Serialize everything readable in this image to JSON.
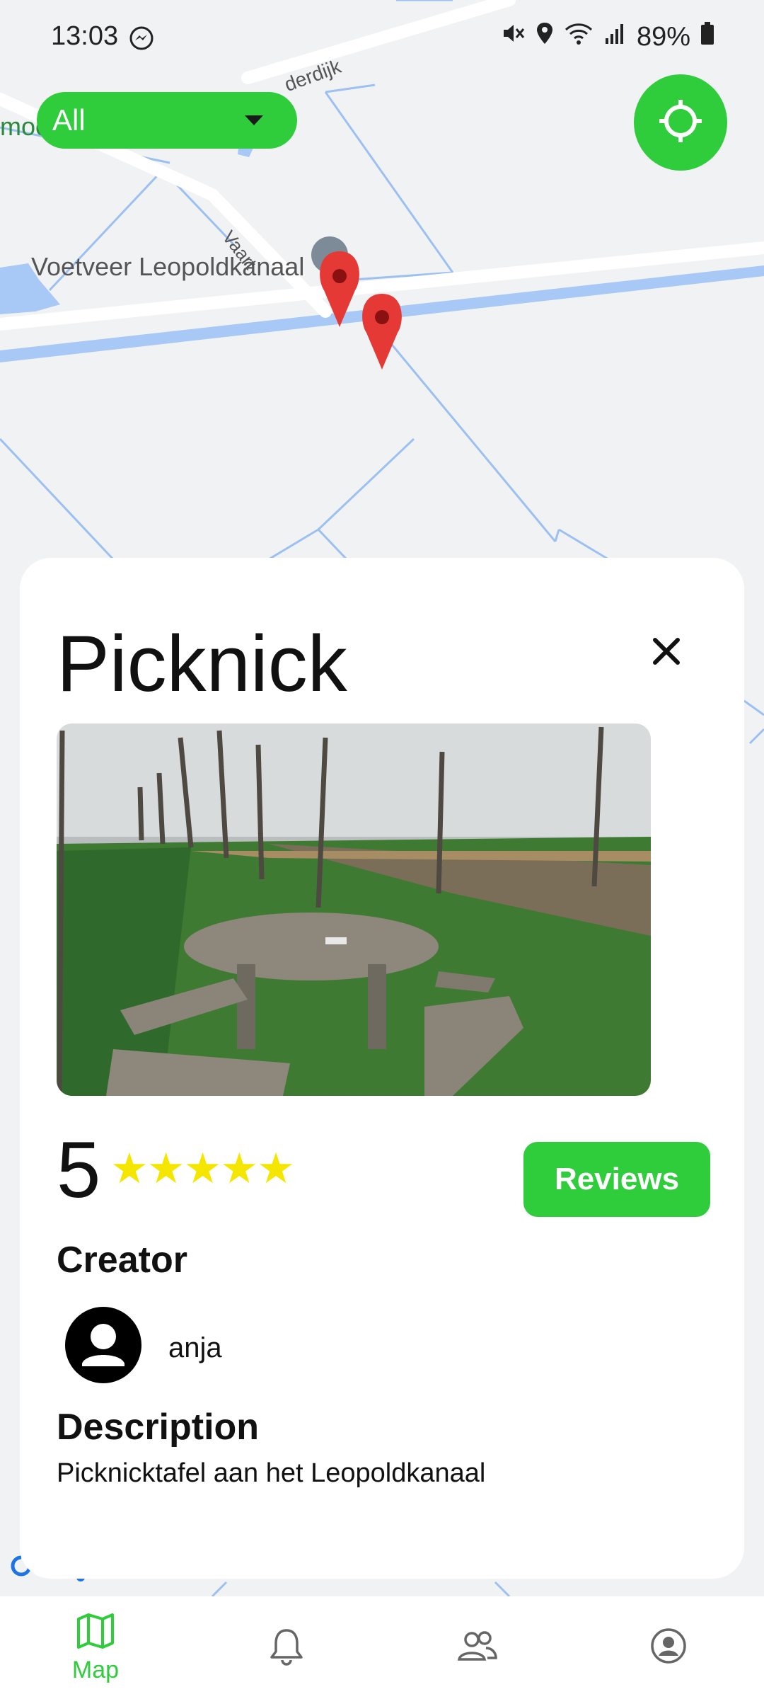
{
  "status": {
    "time": "13:03",
    "battery": "89%"
  },
  "filter": {
    "selected": "All"
  },
  "map": {
    "labels": {
      "place": "Voetveer Leopoldkanaal",
      "road_vaart": "Vaart",
      "road_dijk": "derdijk",
      "left_cut": "moo"
    }
  },
  "poi": {
    "title": "Picknick",
    "rating": "5",
    "stars": "★★★★★",
    "reviews_label": "Reviews",
    "creator_heading": "Creator",
    "creator_name": "anja",
    "description_heading": "Description",
    "description": "Picknicktafel aan het Leopoldkanaal"
  },
  "nav": {
    "items": [
      {
        "label": "Map",
        "icon": "map-icon",
        "active": true
      },
      {
        "label": "",
        "icon": "bell-icon",
        "active": false
      },
      {
        "label": "",
        "icon": "people-icon",
        "active": false
      },
      {
        "label": "",
        "icon": "account-icon",
        "active": false
      }
    ]
  },
  "colors": {
    "accent": "#2fcc3c",
    "star": "#f5e600",
    "marker": "#e53935"
  }
}
